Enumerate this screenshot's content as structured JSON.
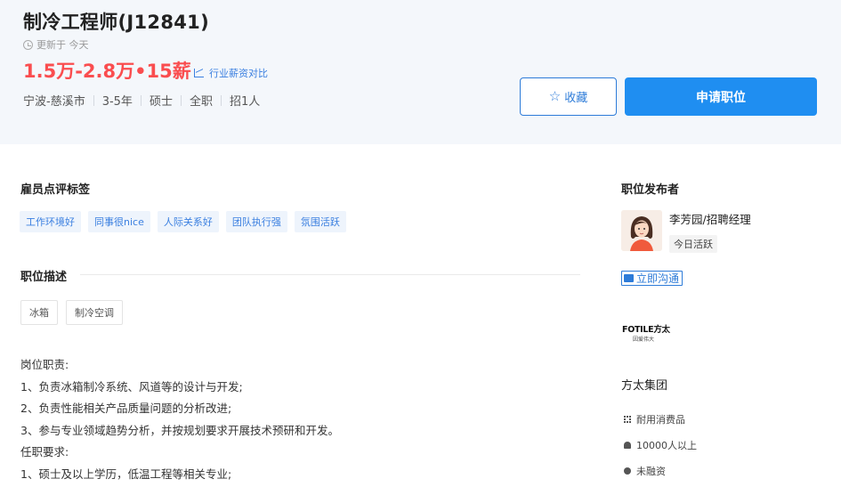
{
  "job": {
    "title": "制冷工程师(J12841)",
    "updated": "更新于 今天",
    "salary": "1.5万-2.8万•15薪",
    "compare_link": "行业薪资对比",
    "meta": [
      "宁波-慈溪市",
      "3-5年",
      "硕士",
      "全职",
      "招1人"
    ]
  },
  "actions": {
    "favorite_label": "收藏",
    "apply_label": "申请职位"
  },
  "employee_tags": {
    "title": "雇员点评标签",
    "tags": [
      "工作环境好",
      "同事很nice",
      "人际关系好",
      "团队执行强",
      "氛围活跃"
    ]
  },
  "description": {
    "title": "职位描述",
    "keywords": [
      "冰箱",
      "制冷空调"
    ],
    "lines": [
      "岗位职责:",
      "1、负责冰箱制冷系统、风道等的设计与开发;",
      "2、负责性能相关产品质量问题的分析改进;",
      "3、参与专业领域趋势分析，并按规划要求开展技术预研和开发。",
      "任职要求:",
      "1、硕士及以上学历，低温工程等相关专业;"
    ]
  },
  "publisher": {
    "title": "职位发布者",
    "name": "李芳园/招聘经理",
    "status": "今日活跃",
    "chat_label": "立即沟通"
  },
  "company": {
    "logo_text": "FOTILE方太",
    "logo_sub": "因爱伟大",
    "name": "方太集团",
    "industry": "耐用消费品",
    "size": "10000人以上",
    "financing": "未融资"
  },
  "colors": {
    "accent": "#1f8ef1",
    "salary": "#fa4d4f",
    "header_bg": "#f4f7fb"
  }
}
